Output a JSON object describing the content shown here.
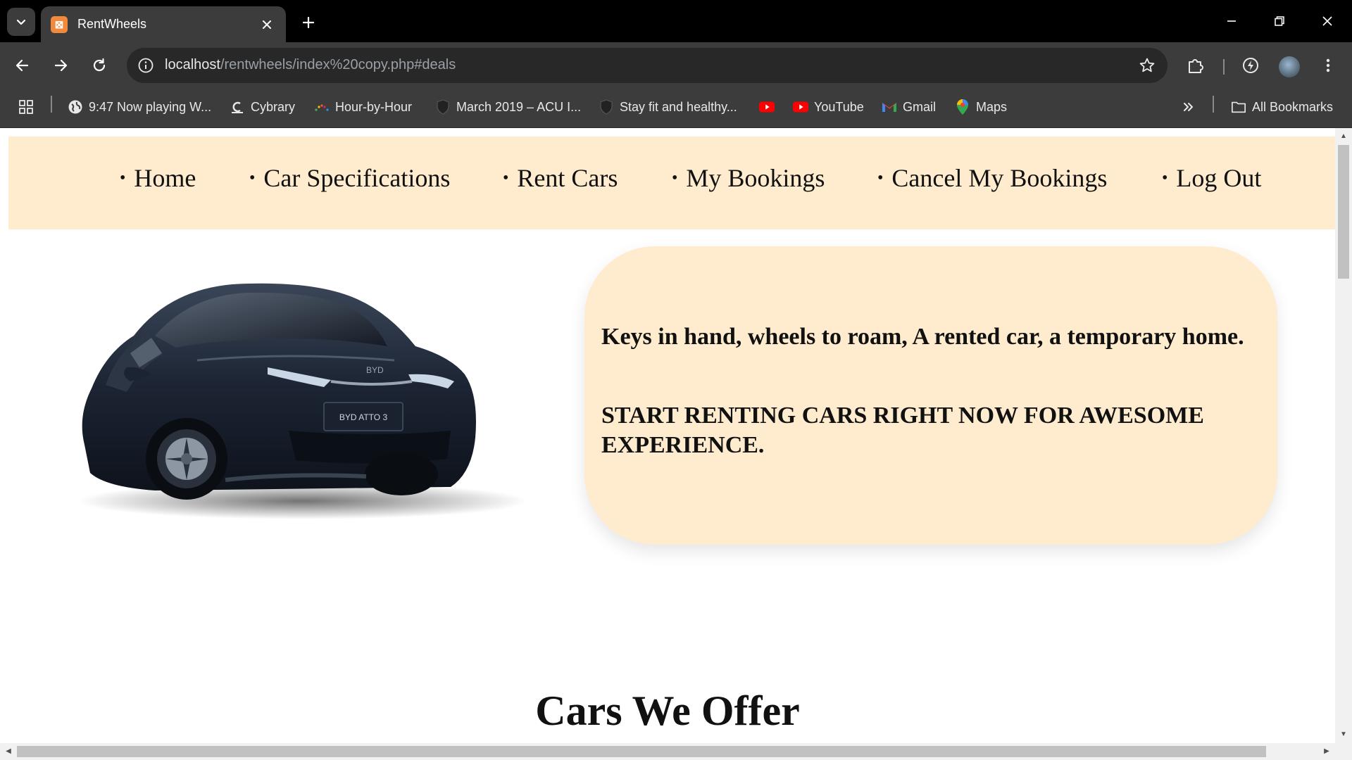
{
  "browser": {
    "tab_title": "RentWheels",
    "url_host": "localhost",
    "url_path": "/rentwheels/index%20copy.php#deals",
    "bookmarks": [
      {
        "label": "9:47 Now playing W...",
        "icon": "globe-icon"
      },
      {
        "label": "Cybrary",
        "icon": "cybrary-icon"
      },
      {
        "label": "Hour-by-Hour",
        "icon": "weather-icon"
      },
      {
        "label": "March 2019 – ACU I...",
        "icon": "shield-icon"
      },
      {
        "label": "Stay fit and healthy...",
        "icon": "shield-icon"
      },
      {
        "label": "",
        "icon": "youtube-icon"
      },
      {
        "label": "YouTube",
        "icon": "youtube-icon"
      },
      {
        "label": "Gmail",
        "icon": "gmail-icon"
      },
      {
        "label": "Maps",
        "icon": "maps-icon"
      }
    ],
    "all_bookmarks": "All Bookmarks"
  },
  "nav": {
    "items": [
      "Home",
      "Car Specifications",
      "Rent Cars",
      "My Bookings",
      "Cancel My Bookings",
      "Log Out"
    ]
  },
  "hero": {
    "line1": "Keys in hand, wheels to roam, A rented car, a temporary home.",
    "line2": "START RENTING CARS RIGHT NOW FOR AWESOME EXPERIENCE.",
    "car_plate": "BYD ATTO 3",
    "car_badge": "BYD"
  },
  "section": {
    "title": "Cars We Offer"
  },
  "colors": {
    "nav_bg": "#ffebcd",
    "hero_bg": "#ffebcd",
    "favicon": "#f08a3c"
  }
}
